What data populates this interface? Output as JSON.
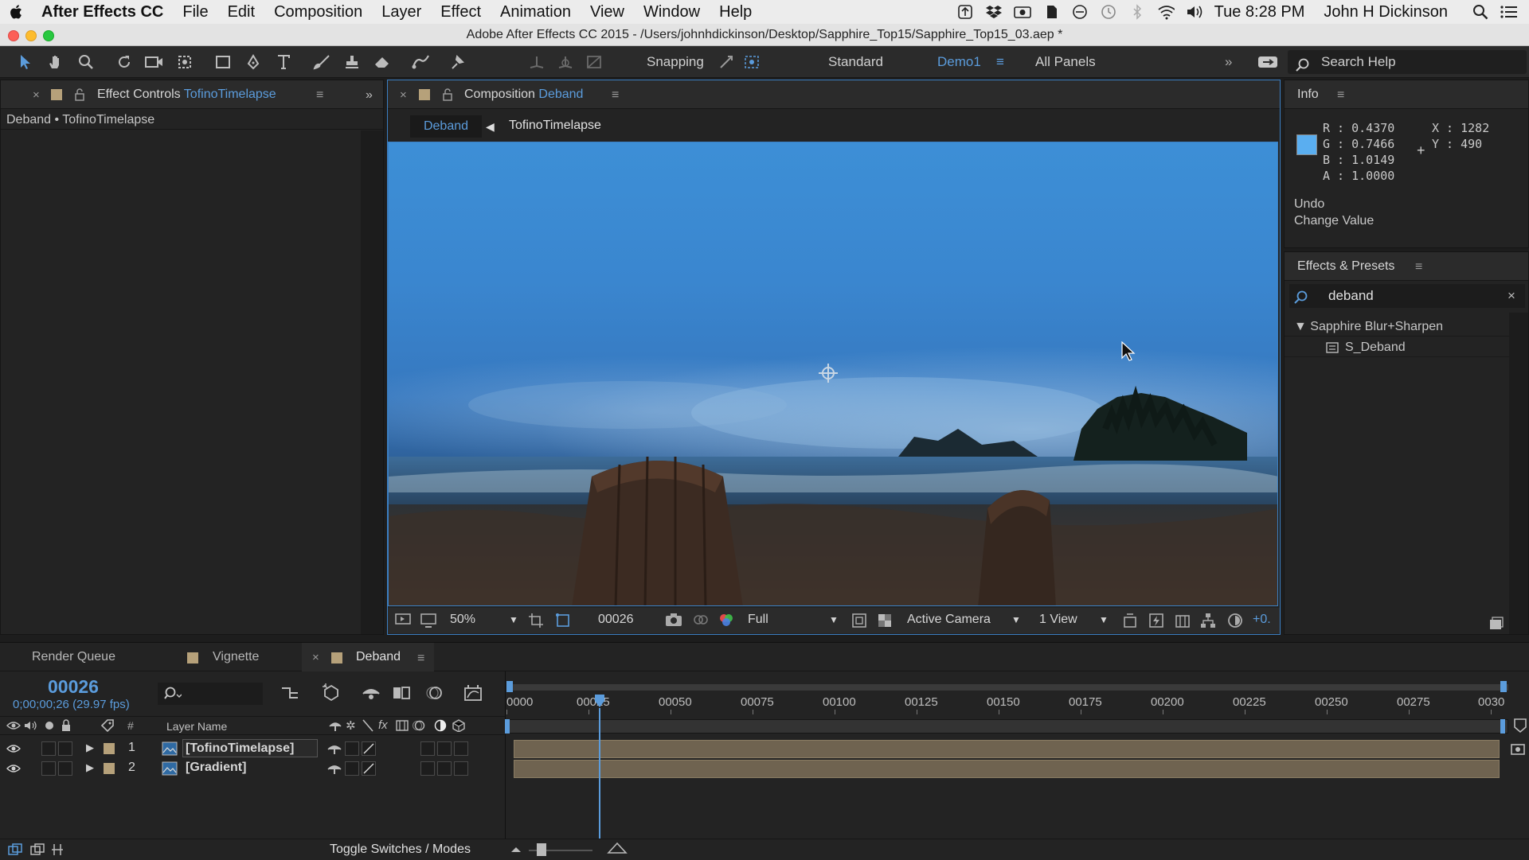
{
  "menubar": {
    "apple": "",
    "app_name": "After Effects CC",
    "items": [
      "File",
      "Edit",
      "Composition",
      "Layer",
      "Effect",
      "Animation",
      "View",
      "Window",
      "Help"
    ],
    "clock": "Tue 8:28 PM",
    "user": "John H Dickinson"
  },
  "window": {
    "title": "Adobe After Effects CC 2015 - /Users/johnhdickinson/Desktop/Sapphire_Top15/Sapphire_Top15_03.aep *"
  },
  "toolbar": {
    "snapping_label": "Snapping",
    "workspaces": [
      "Standard",
      "Demo1",
      "All Panels"
    ],
    "active_workspace": "Demo1",
    "search_help_placeholder": "Search Help"
  },
  "effect_controls": {
    "tab_prefix": "Effect Controls",
    "tab_layer": "TofinoTimelapse",
    "breadcrumb": "Deband • TofinoTimelapse"
  },
  "composition": {
    "tab_prefix": "Composition",
    "tab_name": "Deband",
    "crumbs": [
      "Deband",
      "TofinoTimelapse"
    ],
    "zoom": "50%",
    "timecode": "00026",
    "resolution": "Full",
    "camera": "Active Camera",
    "views": "1 View",
    "exposure": "+0."
  },
  "info": {
    "title": "Info",
    "r": "R : 0.4370",
    "g": "G : 0.7466",
    "b": "B : 1.0149",
    "a": "A : 1.0000",
    "x": "X : 1282",
    "y": "Y : 490",
    "swatch_color": "#5aaef0",
    "undo_label": "Undo",
    "undo_action": "Change Value"
  },
  "effects_presets": {
    "title": "Effects & Presets",
    "search_value": "deband",
    "category": "Sapphire Blur+Sharpen",
    "item": "S_Deband"
  },
  "timeline": {
    "tabs": [
      "Render Queue",
      "Vignette",
      "Deband"
    ],
    "active_tab": "Deband",
    "current_time": "00026",
    "timecode_fps": "0;00;00;26 (29.97 fps)",
    "header_hash": "#",
    "header_layer_name": "Layer Name",
    "ruler": [
      "0000",
      "00025",
      "00050",
      "00075",
      "00100",
      "00125",
      "00150",
      "00175",
      "00200",
      "00225",
      "00250",
      "00275",
      "0030"
    ],
    "layers": [
      {
        "num": "1",
        "name": "[TofinoTimelapse]"
      },
      {
        "num": "2",
        "name": "[Gradient]"
      }
    ],
    "toggle_label": "Toggle Switches / Modes"
  },
  "colors": {
    "accent": "#5b9cdc",
    "label_tan": "#b6a17a",
    "panel_bg": "#232323"
  }
}
